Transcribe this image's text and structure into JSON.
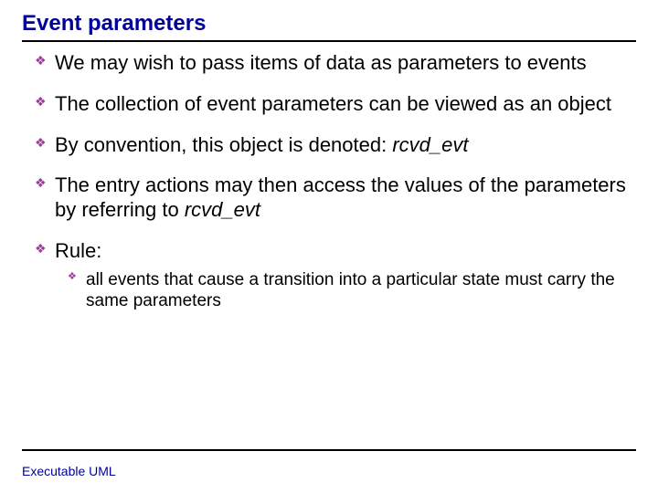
{
  "title": "Event parameters",
  "bullets": {
    "b1": "We may wish to pass items of data as parameters to events",
    "b2": "The collection of event parameters can be viewed as an object",
    "b3_pre": "By convention, this object is denoted: ",
    "b3_em": "rcvd_evt",
    "b4_pre": "The entry actions may then access the values of the parameters by referring to ",
    "b4_em": "rcvd_evt",
    "b5": "Rule:",
    "b5_sub": "all events that cause a transition into a particular state must carry the same parameters"
  },
  "footer": "Executable UML"
}
